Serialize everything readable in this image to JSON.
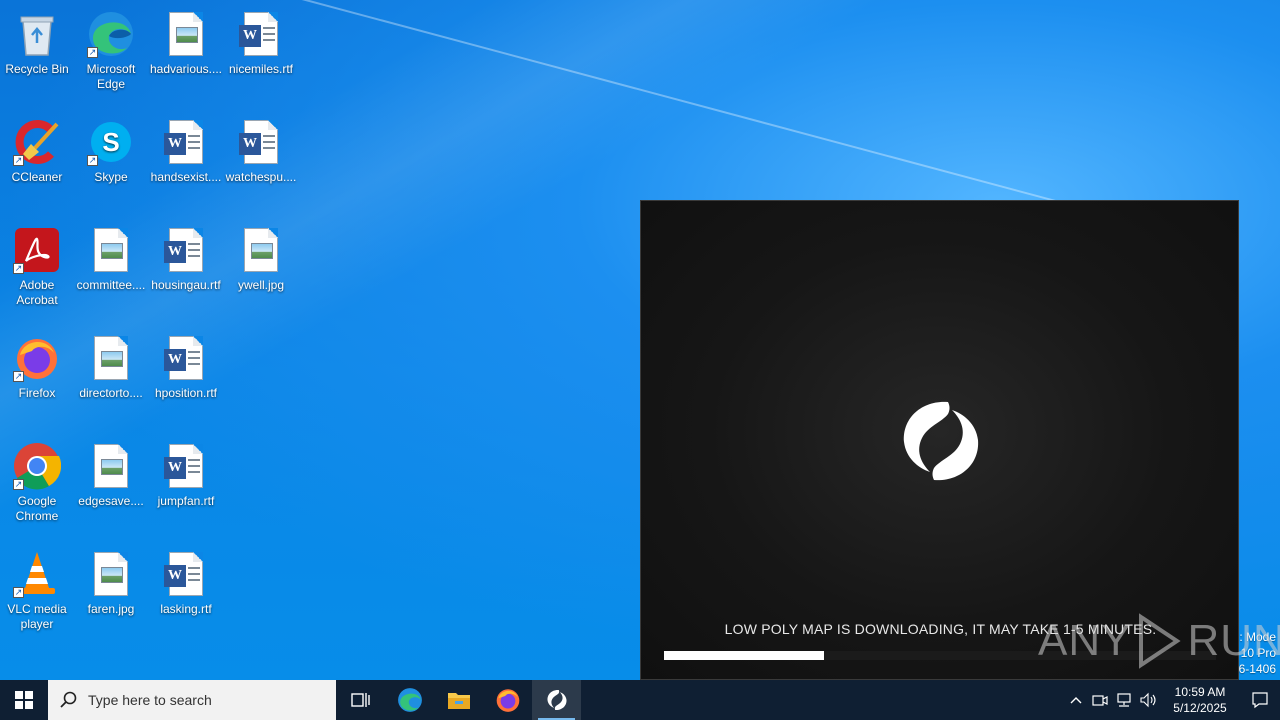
{
  "desktop": {
    "icons": [
      {
        "label": "Recycle Bin",
        "kind": "recycle-bin"
      },
      {
        "label": "Microsoft Edge",
        "kind": "edge"
      },
      {
        "label": "hadvarious....",
        "kind": "image-file"
      },
      {
        "label": "nicemiles.rtf",
        "kind": "word-file"
      },
      {
        "label": "CCleaner",
        "kind": "ccleaner"
      },
      {
        "label": "Skype",
        "kind": "skype"
      },
      {
        "label": "handsexist....",
        "kind": "word-file"
      },
      {
        "label": "watchespu....",
        "kind": "word-file"
      },
      {
        "label": "Adobe Acrobat",
        "kind": "acrobat"
      },
      {
        "label": "committee....",
        "kind": "image-file"
      },
      {
        "label": "housingau.rtf",
        "kind": "word-file"
      },
      {
        "label": "ywell.jpg",
        "kind": "image-file"
      },
      {
        "label": "Firefox",
        "kind": "firefox"
      },
      {
        "label": "directorto....",
        "kind": "image-file"
      },
      {
        "label": "hposition.rtf",
        "kind": "word-file"
      },
      {
        "label": "Google Chrome",
        "kind": "chrome"
      },
      {
        "label": "edgesave....",
        "kind": "image-file"
      },
      {
        "label": "jumpfan.rtf",
        "kind": "word-file"
      },
      {
        "label": "VLC media player",
        "kind": "vlc"
      },
      {
        "label": "faren.jpg",
        "kind": "image-file"
      },
      {
        "label": "lasking.rtf",
        "kind": "word-file"
      }
    ],
    "win_mark": {
      "line1": ": Mode",
      "line2": "10 Pro",
      "line3": "6-1406"
    },
    "watermark": {
      "left": "ANY",
      "right": "RUN"
    }
  },
  "app_window": {
    "loading_text": "LOW POLY MAP IS DOWNLOADING, IT MAY TAKE 1-5 MINUTES.",
    "progress": 0.29,
    "logo_icon": "swirl-logo-icon"
  },
  "taskbar": {
    "search_placeholder": "Type here to search",
    "pinned": [
      {
        "name": "task-view",
        "icon": "task-view-icon"
      },
      {
        "name": "edge",
        "icon": "edge-icon"
      },
      {
        "name": "file-explorer",
        "icon": "folder-icon"
      },
      {
        "name": "firefox",
        "icon": "firefox-icon"
      },
      {
        "name": "app",
        "icon": "swirl-logo-icon",
        "active": true
      }
    ],
    "clock": {
      "time": "10:59 AM",
      "date": "5/12/2025"
    }
  },
  "colors": {
    "taskbar": "#0f1f33",
    "desktop_blue": "#0b86e6",
    "accent": "#76b9ed"
  }
}
